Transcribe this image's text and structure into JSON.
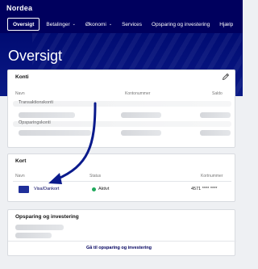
{
  "header": {
    "logo": "Nordea",
    "nav": [
      {
        "label": "Oversigt",
        "active": true
      },
      {
        "label": "Betalinger",
        "dropdown": true
      },
      {
        "label": "Økonomi",
        "dropdown": true
      },
      {
        "label": "Services"
      },
      {
        "label": "Opsparing og investering"
      },
      {
        "label": "Hjælp"
      }
    ],
    "title": "Oversigt"
  },
  "konti": {
    "title": "Konti",
    "headers": {
      "name": "Navn",
      "number": "Kontonummer",
      "balance": "Saldo"
    },
    "rows": [
      {
        "name": "Transaktionskonti"
      },
      {
        "name": "Opsparingskonti"
      }
    ],
    "edit_icon": "pencil-icon"
  },
  "kort": {
    "title": "Kort",
    "headers": {
      "name": "Navn",
      "status": "Status",
      "number": "Kortnummer"
    },
    "card": {
      "name": "Visa/Dankort",
      "status": "Aktivt",
      "number": "4571 **** ****"
    }
  },
  "opsparing": {
    "title": "Opsparing og investering",
    "link": "Gå til opsparing og investering"
  },
  "colors": {
    "brand": "#00005e",
    "active_status": "#1fa85b",
    "annotation_arrow": "#0a1a8c"
  }
}
